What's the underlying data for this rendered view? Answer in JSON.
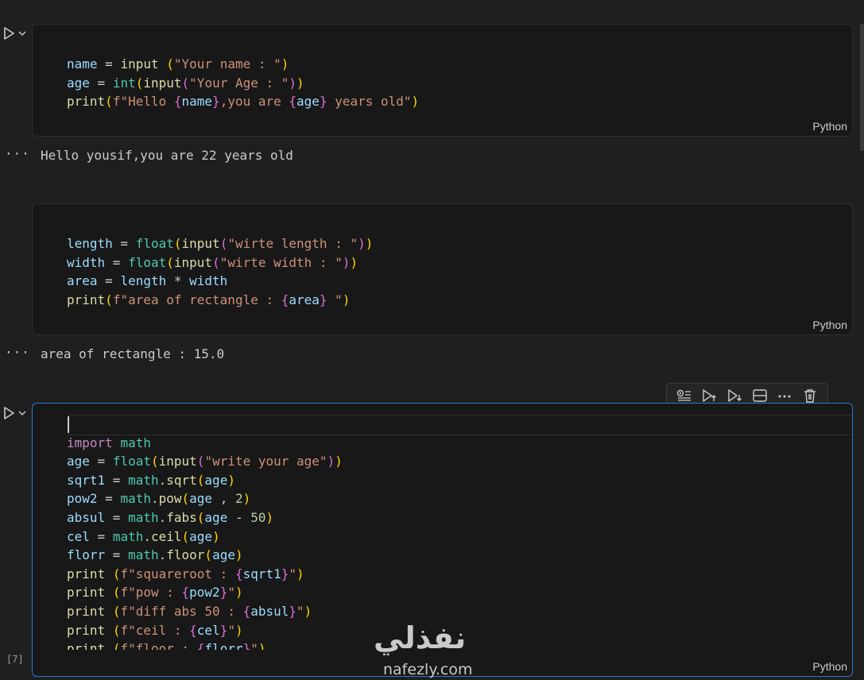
{
  "cells": [
    {
      "language": "Python",
      "code": [
        "name = input (\"Your name : \")",
        "age = int(input(\"Your Age : \"))",
        "print(f\"Hello {name},you are {age} years old\")"
      ],
      "output": "Hello yousif,you are 22 years old"
    },
    {
      "language": "Python",
      "code": [
        "length = float(input(\"wirte length : \"))",
        "width = float(input(\"wirte width : \"))",
        "area = length * width",
        "print(f\"area of rectangle : {area} \")"
      ],
      "output": "area of rectangle : 15.0"
    },
    {
      "language": "Python",
      "execution_count": "[7]",
      "code": [
        "",
        "import math",
        "age = float(input(\"write your age\"))",
        "sqrt1 = math.sqrt(age)",
        "pow2 = math.pow(age , 2)",
        "absul = math.fabs(age - 50)",
        "cel = math.ceil(age)",
        "florr = math.floor(age)",
        "print (f\"squareroot : {sqrt1}\")",
        "print (f\"pow : {pow2}\")",
        "print (f\"diff abs 50 : {absul}\")",
        "print (f\"ceil : {cel}\")",
        "print (f\"floor : {florr}\")"
      ]
    }
  ],
  "output_menu_label": "···",
  "cell_toolbar": [
    "execute-above-icon",
    "run-above-icon",
    "run-below-icon",
    "split-cell-icon",
    "more-icon",
    "trash-icon"
  ],
  "watermark": {
    "arabic": "نفذلي",
    "latin": "nafezly.com"
  },
  "colors": {
    "accent": "#2b79d0",
    "keyword": "#c586c0",
    "function": "#dcdcaa",
    "variable": "#9cdcfe",
    "string": "#ce9178",
    "number": "#b5cea8"
  }
}
